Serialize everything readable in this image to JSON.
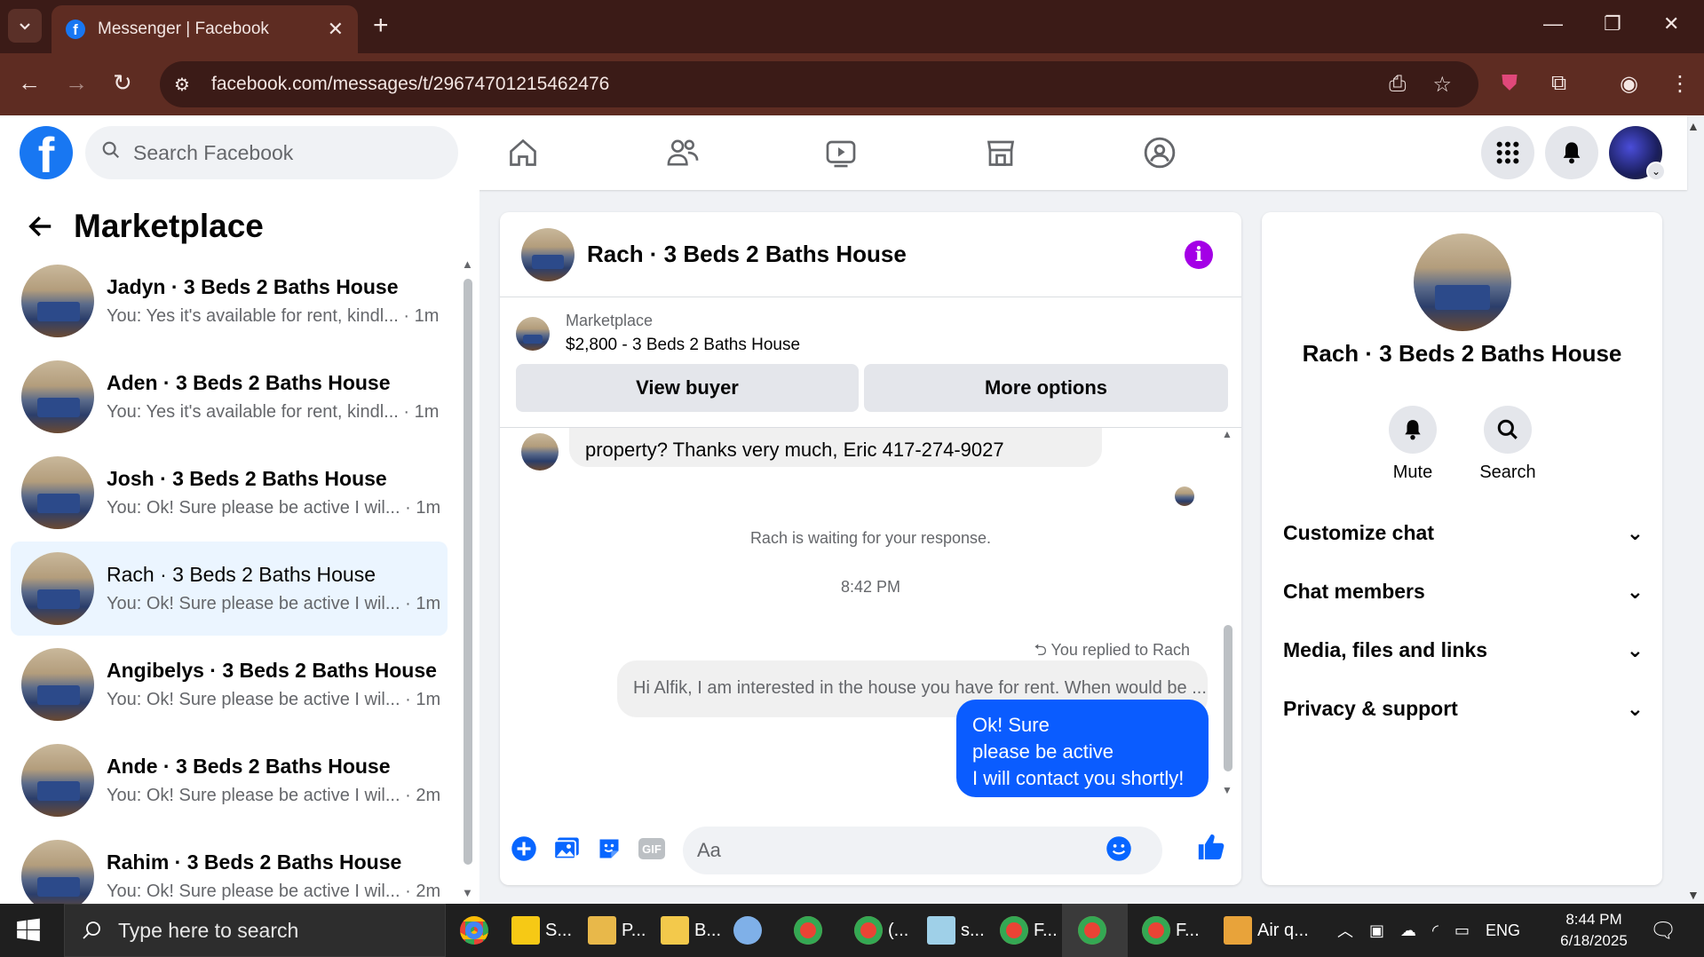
{
  "browser": {
    "tab_title": "Messenger | Facebook",
    "url": "facebook.com/messages/t/29674701215462476"
  },
  "fb": {
    "search_placeholder": "Search Facebook"
  },
  "sidebar": {
    "title": "Marketplace",
    "conversations": [
      {
        "name": "Jadyn · 3 Beds 2 Baths House",
        "preview": "You: Yes it's available for rent, kindl... · 1m"
      },
      {
        "name": "Aden · 3 Beds 2 Baths House",
        "preview": "You: Yes it's available for rent, kindl... · 1m"
      },
      {
        "name": "Josh · 3 Beds 2 Baths House",
        "preview": "You: Ok! Sure please be active I wil... · 1m"
      },
      {
        "name": "Rach · 3 Beds 2 Baths House",
        "preview": "You: Ok! Sure please be active I wil... · 1m"
      },
      {
        "name": "Angibelys · 3 Beds 2 Baths House",
        "preview": "You: Ok! Sure please be active I wil... · 1m"
      },
      {
        "name": "Ande · 3 Beds 2 Baths House",
        "preview": "You: Ok! Sure please be active I wil... · 2m"
      },
      {
        "name": "Rahim · 3 Beds 2 Baths House",
        "preview": "You: Ok! Sure please be active I wil... · 2m"
      }
    ]
  },
  "chat": {
    "title": "Rach · 3 Beds 2 Baths House",
    "listing_source": "Marketplace",
    "listing_title": "$2,800 - 3 Beds 2 Baths House",
    "view_buyer": "View buyer",
    "more_options": "More options",
    "incoming_text": "property? Thanks very much, Eric 417-274-9027",
    "waiting": "Rach is waiting for your response.",
    "time": "8:42 PM",
    "replied_to": "You replied to Rach",
    "quoted": "Hi Alfik, I am interested in the house you have for rent. When would be ...",
    "outgoing": "Ok! Sure\n please be active\nI will contact you shortly!",
    "composer_placeholder": "Aa"
  },
  "details": {
    "name": "Rach · 3 Beds 2 Baths House",
    "mute": "Mute",
    "search": "Search",
    "rows": [
      "Customize chat",
      "Chat members",
      "Media, files and links",
      "Privacy & support"
    ]
  },
  "taskbar": {
    "search_placeholder": "Type here to search",
    "apps": [
      "S...",
      "P...",
      "B...",
      "(...",
      "s...",
      "F...",
      "F...",
      "Air q..."
    ],
    "lang": "ENG",
    "time": "8:44 PM",
    "date": "6/18/2025"
  },
  "colors": {
    "fb_blue": "#1877f2",
    "out_bubble": "#0a5cff",
    "info_purple": "#a400e6",
    "chrome_dark": "#3b1b17",
    "chrome_bar": "#5e2c22"
  }
}
